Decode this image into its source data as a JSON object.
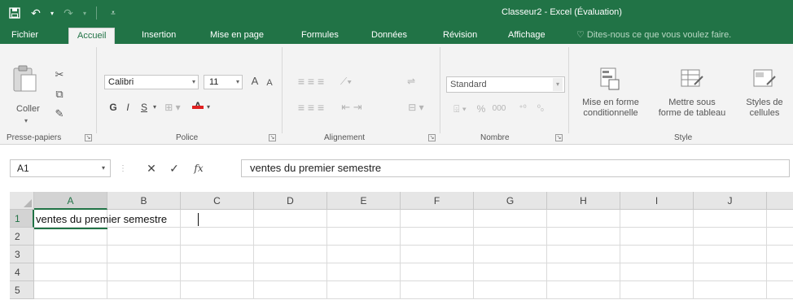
{
  "window": {
    "title": "Classeur2 - Excel (Évaluation)",
    "accent_color": "#217346",
    "qat": {
      "save_icon": "save-icon",
      "undo_icon": "undo-icon",
      "redo_icon": "redo-icon",
      "customize_icon": "customize-qat-icon"
    }
  },
  "tabs": [
    {
      "label": "Fichier"
    },
    {
      "label": "Accueil",
      "active": true
    },
    {
      "label": "Insertion"
    },
    {
      "label": "Mise en page"
    },
    {
      "label": "Formules"
    },
    {
      "label": "Données"
    },
    {
      "label": "Révision"
    },
    {
      "label": "Affichage"
    }
  ],
  "tell_me": {
    "text": "Dites-nous ce que vous voulez faire."
  },
  "ribbon": {
    "clipboard": {
      "paste_label": "Coller",
      "group_label": "Presse-papiers"
    },
    "font": {
      "font_name": "Calibri",
      "font_size": "11",
      "bold": "G",
      "italic": "I",
      "underline": "S",
      "grow": "A",
      "shrink": "A",
      "color_letter": "A",
      "group_label": "Police"
    },
    "alignment": {
      "group_label": "Alignement"
    },
    "number": {
      "format": "Standard",
      "percent": "%",
      "thousands": "000",
      "group_label": "Nombre"
    },
    "style": {
      "conditional": "Mise en forme conditionnelle",
      "table": "Mettre sous forme de tableau",
      "cell_styles": "Styles de cellules",
      "group_label": "Style"
    }
  },
  "formula_bar": {
    "name_box": "A1",
    "cancel": "✕",
    "enter": "✓",
    "fx": "fx",
    "content": "ventes du premier semestre"
  },
  "grid": {
    "columns": [
      "A",
      "B",
      "C",
      "D",
      "E",
      "F",
      "G",
      "H",
      "I",
      "J"
    ],
    "rows": [
      "1",
      "2",
      "3",
      "4",
      "5"
    ],
    "active_cell": "A1",
    "cell_a1": "ventes du premier semestre"
  }
}
